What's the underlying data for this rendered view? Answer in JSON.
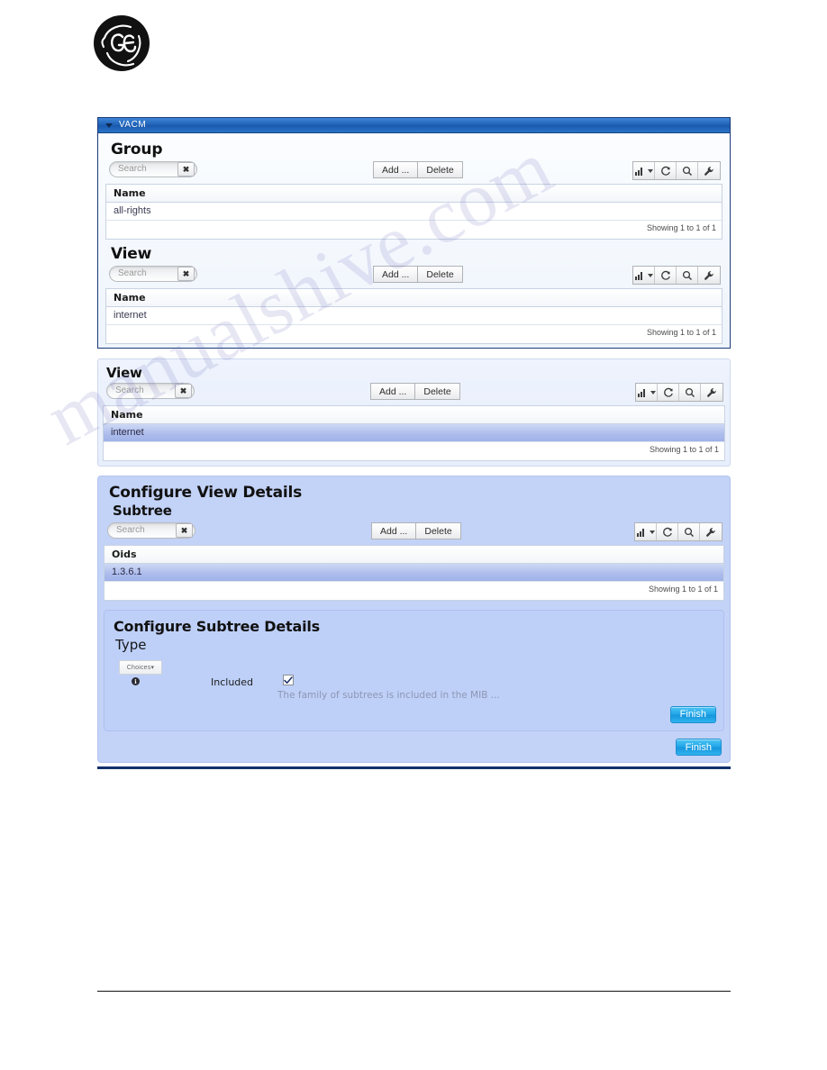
{
  "brand": {
    "logo": "ge-monogram-logo"
  },
  "watermark": {
    "text": "manualshive.com"
  },
  "vacm_panel": {
    "title": "VACM",
    "collapse_icon": "triangle-down-icon",
    "group_section": {
      "heading": "Group",
      "search": {
        "placeholder": "Search",
        "value": "",
        "clear_icon": "clear-x-icon"
      },
      "buttons": {
        "add": "Add ...",
        "delete": "Delete"
      },
      "toolbar_icons": [
        "chart-icon",
        "refresh-icon",
        "search-icon",
        "wrench-icon"
      ],
      "column_header": "Name",
      "rows": [
        "all-rights"
      ],
      "footer": "Showing 1 to 1 of 1"
    },
    "view_section": {
      "heading": "View",
      "search": {
        "placeholder": "Search",
        "value": "",
        "clear_icon": "clear-x-icon"
      },
      "buttons": {
        "add": "Add ...",
        "delete": "Delete"
      },
      "toolbar_icons": [
        "chart-icon",
        "refresh-icon",
        "search-icon",
        "wrench-icon"
      ],
      "column_header": "Name",
      "rows": [
        "internet"
      ],
      "footer": "Showing 1 to 1 of 1"
    }
  },
  "view_panel": {
    "heading": "View",
    "search": {
      "placeholder": "Search",
      "value": "",
      "clear_icon": "clear-x-icon"
    },
    "buttons": {
      "add": "Add ...",
      "delete": "Delete"
    },
    "toolbar_icons": [
      "chart-icon",
      "refresh-icon",
      "search-icon",
      "wrench-icon"
    ],
    "column_header": "Name",
    "rows": [
      {
        "name": "internet",
        "selected": true
      }
    ],
    "footer": "Showing 1 to 1 of 1"
  },
  "configure_view_details": {
    "heading": "Configure View Details",
    "subheading": "Subtree",
    "search": {
      "placeholder": "Search",
      "value": "",
      "clear_icon": "clear-x-icon"
    },
    "buttons": {
      "add": "Add ...",
      "delete": "Delete"
    },
    "toolbar_icons": [
      "chart-icon",
      "refresh-icon",
      "search-icon",
      "wrench-icon"
    ],
    "column_header": "Oids",
    "rows": [
      {
        "oid": "1.3.6.1",
        "selected": true
      }
    ],
    "footer": "Showing 1 to 1 of 1",
    "finish_label": "Finish"
  },
  "configure_subtree_details": {
    "heading": "Configure Subtree Details",
    "subheading": "Type",
    "choices_label": "Choices",
    "choices_caret": "caret-down-icon",
    "info_icon": "info-icon",
    "field_label": "Included",
    "checkbox_checked": true,
    "help_text": "The family of subtrees is included in the MIB ...",
    "finish_label": "Finish"
  },
  "colors": {
    "titlebar_blue": "#1f62b8",
    "panel_blue": "#c3d2f7",
    "row_selected": "#aebdec",
    "finish_button": "#23a8e8",
    "rule_dark": "#11306b"
  }
}
